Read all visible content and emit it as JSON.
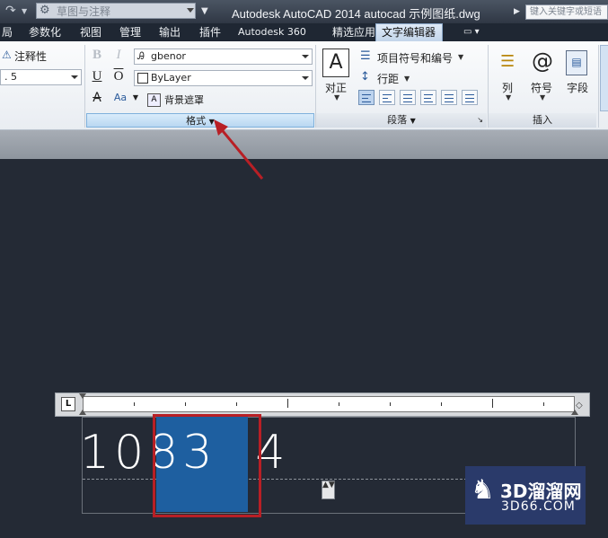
{
  "titlebar": {
    "workspace": "草图与注释",
    "app_title": "Autodesk AutoCAD 2014    autocad 示例图纸.dwg",
    "search_placeholder": "键入关键字或短语"
  },
  "tabs": [
    "局",
    "参数化",
    "视图",
    "管理",
    "输出",
    "插件",
    "Autodesk 360",
    "精选应用",
    "文字编辑器"
  ],
  "active_tab": "文字编辑器",
  "ribbon": {
    "style": {
      "annotative_label": "注释性",
      "height_value": ". 5"
    },
    "format": {
      "bold": "B",
      "italic": "I",
      "underline": "U",
      "overline": "O",
      "strike": "A",
      "case": "Aa",
      "font_value": "gbenor",
      "color_value": "ByLayer",
      "bg_mask_label": "背景遮罩",
      "title": "格式"
    },
    "paragraph": {
      "justify_label": "对正",
      "bullets_label": "项目符号和编号",
      "spacing_label": "行距",
      "title": "段落"
    },
    "insert": {
      "columns_label": "列",
      "symbol_label": "符号",
      "field_label": "字段",
      "title": "插入"
    }
  },
  "editor": {
    "ruler_tab_label": "L",
    "text_before": "108",
    "text_selected": "3  4",
    "stack_handle": "▲▼"
  },
  "watermark": {
    "title": "3D溜溜网",
    "subtitle": "3D66.COM"
  },
  "colors": {
    "selection": "#1e5fa0",
    "highlight_box": "#b81f25",
    "arrow": "#b81f25",
    "canvas": "#242a35"
  }
}
